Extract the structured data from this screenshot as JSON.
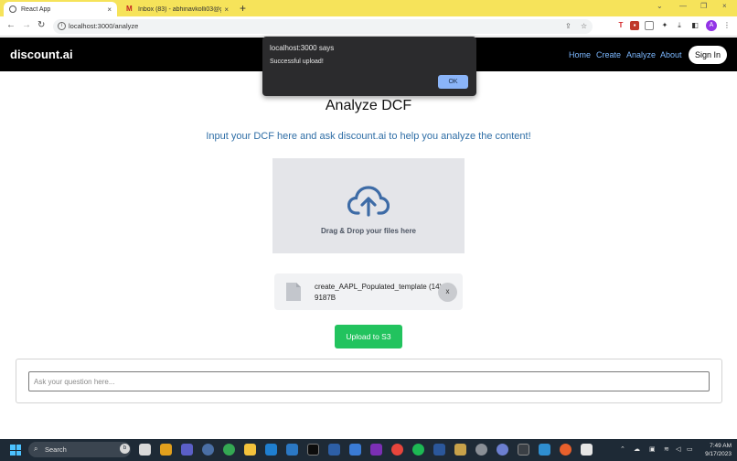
{
  "browser": {
    "tabs": [
      {
        "title": "React App",
        "close": "×"
      },
      {
        "title": "Inbox (83) - abhinavkolli03@gm...",
        "close": "×"
      }
    ],
    "new_tab": "+",
    "window_controls": [
      "⌄",
      "—",
      "❐",
      "×"
    ],
    "url": "localhost:3000/analyze",
    "profile_initial": "A"
  },
  "navbar": {
    "brand": "discount.ai",
    "links": [
      "Home",
      "Create",
      "Analyze",
      "About"
    ],
    "sign_in": "Sign In"
  },
  "alert": {
    "title": "localhost:3000 says",
    "message": "Successful upload!",
    "ok": "OK"
  },
  "main": {
    "title": "Analyze DCF",
    "subtitle": "Input your DCF here and ask discount.ai to help you analyze the content!",
    "dropzone_text": "Drag & Drop your files here",
    "file": {
      "name": "create_AAPL_Populated_template (14)",
      "size": "9187B",
      "remove": "x"
    },
    "upload_button": "Upload to S3",
    "question_placeholder": "Ask your question here..."
  },
  "taskbar": {
    "search": "Search",
    "time": "7:49 AM",
    "date": "9/17/2023"
  },
  "colors": {
    "tab_bar": "#f6e35a",
    "navbar": "#000000",
    "nav_link": "#7cb8ff",
    "subtitle": "#2f6ea6",
    "upload_button": "#22c35e",
    "cloud_icon": "#3d6ba6",
    "alert_bg": "#2b2b2d",
    "alert_ok": "#8ab4f8"
  }
}
